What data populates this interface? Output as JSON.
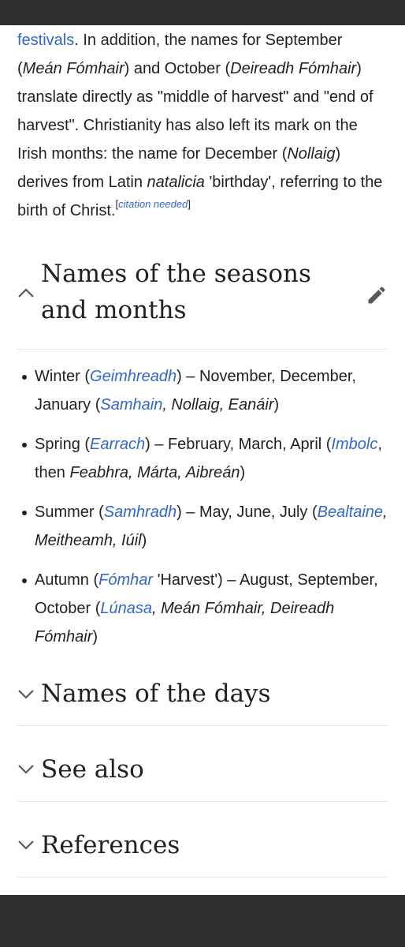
{
  "intro": {
    "line1_link": "festivals",
    "line1_rest": ". In addition, the names for September",
    "p_open1": "(",
    "sept_irish": "Meán Fómhair",
    "and_oct": ") and October (",
    "oct_irish": "Deireadh Fómhair",
    "close1": ")",
    "translate": "translate directly as \"middle of harvest\" and \"end of harvest\". Christianity has also left its mark on the Irish months: the name for December (",
    "dec_irish": "Nollaig",
    "derives": ") derives from Latin ",
    "natalicia": "natalicia",
    "birthday": " 'birthday', referring to the birth of Christ.",
    "cite_open": "[",
    "cite_text": "citation needed",
    "cite_close": "]"
  },
  "sections": {
    "seasons": {
      "title": "Names of the seasons and months",
      "state": "expanded",
      "items": [
        {
          "season": "Winter",
          "open": " (",
          "irish": "Geimhreadh",
          "dash": ") – November, December, January (",
          "m1": "Samhain",
          "m_rest": ", Nollaig, Eanáir",
          "close": ")"
        },
        {
          "season": "Spring",
          "open": " (",
          "irish": "Earrach",
          "dash": ") – February, March, April (",
          "m1": "Imbolc",
          "mid": ", then ",
          "m_rest": "Feabhra, Márta, Aibreán",
          "close": ")"
        },
        {
          "season": "Summer",
          "open": " (",
          "irish": "Samhradh",
          "dash": ") – May, June, July (",
          "m1": "Bealtaine",
          "m_rest": ", Meitheamh, Iúil",
          "close": ")"
        },
        {
          "season": "Autumn",
          "open": " (",
          "irish": "Fómhar",
          "gloss": " 'Harvest'",
          "dash": ") – August, September, October (",
          "m1": "Lúnasa",
          "m_rest": ", Meán Fómhair, Deireadh Fómhair",
          "close": ")"
        }
      ]
    },
    "days": {
      "title": "Names of the days",
      "state": "collapsed"
    },
    "see_also": {
      "title": "See also",
      "state": "collapsed"
    },
    "references": {
      "title": "References",
      "state": "collapsed"
    }
  },
  "icons": {
    "collapse": "chevron-up-icon",
    "expand": "chevron-down-icon",
    "edit": "pencil-icon"
  },
  "colors": {
    "link": "#3366cc",
    "text": "#202122",
    "bar": "#2e2f31"
  }
}
